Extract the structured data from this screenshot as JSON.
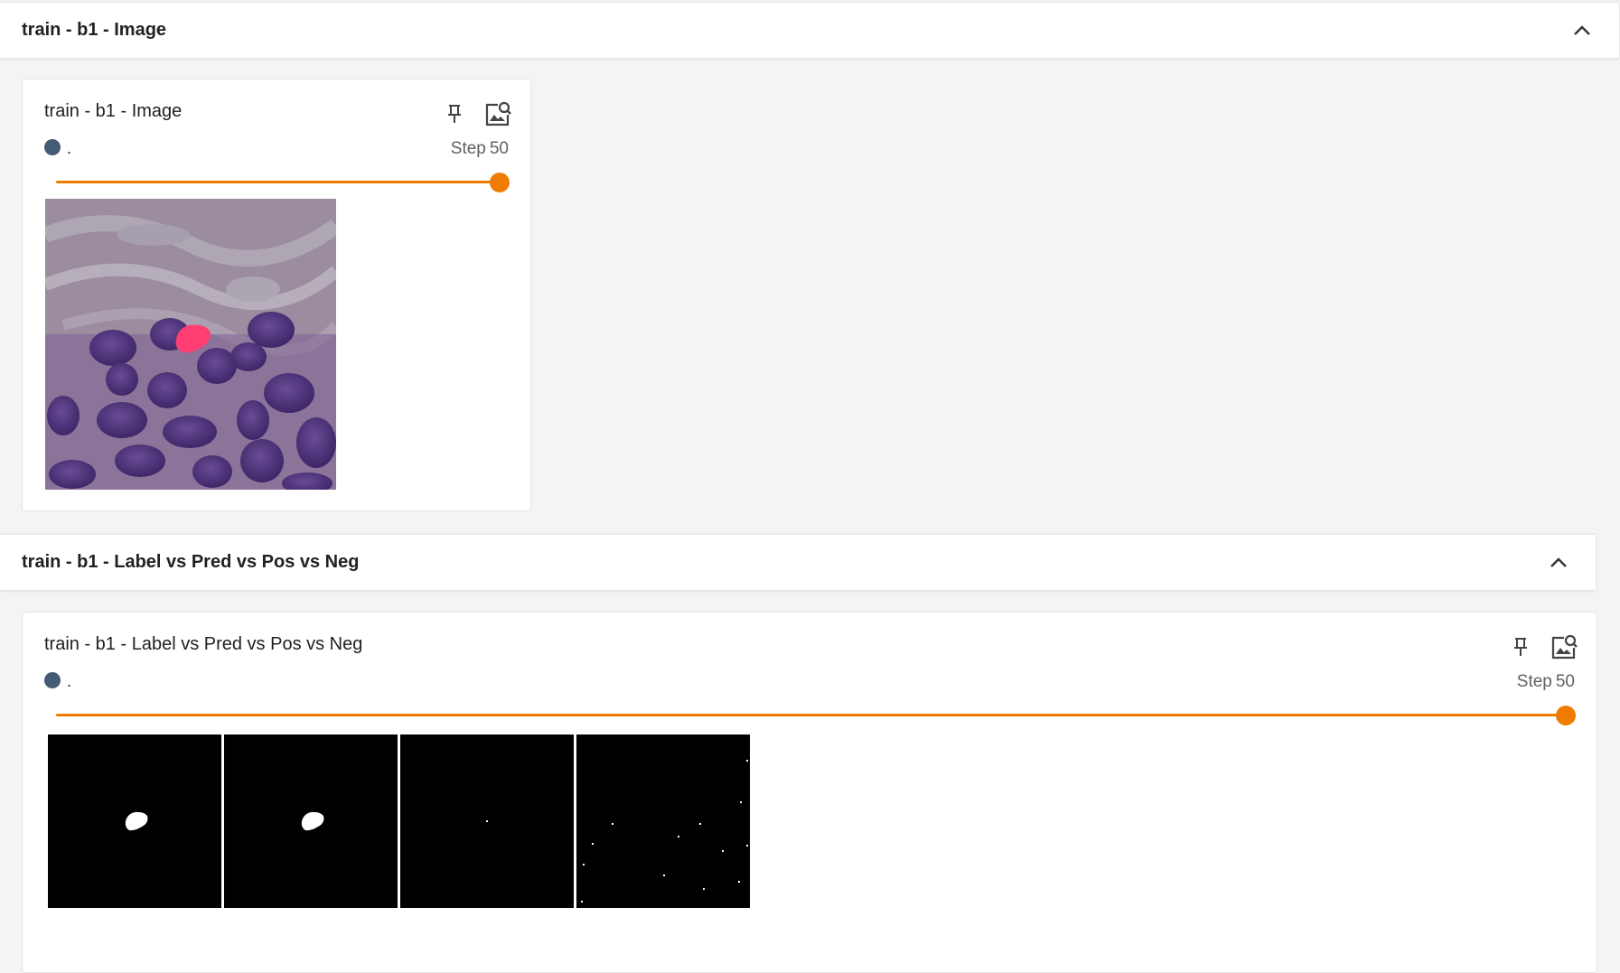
{
  "colors": {
    "accent": "#ef7c00",
    "run_dot": "#455a74",
    "mask_highlight": "#ff3f73"
  },
  "groups": [
    {
      "header_title": "train - b1 - Image",
      "card": {
        "title": "train - b1 - Image",
        "run_name": ".",
        "step_prefix": "Step",
        "step_value": "50",
        "slider_fraction": 1.0,
        "pin_icon": "pin-icon",
        "zoom_icon": "image-search-icon",
        "image_description_icon": "histology-image"
      }
    },
    {
      "header_title": "train - b1 - Label vs Pred vs Pos vs Neg",
      "card": {
        "title": "train - b1 - Label vs Pred vs Pos vs Neg",
        "run_name": ".",
        "step_prefix": "Step",
        "step_value": "50",
        "slider_fraction": 1.0,
        "pin_icon": "pin-icon",
        "zoom_icon": "image-search-icon",
        "panels": [
          "label-mask",
          "pred-mask",
          "pos-mask",
          "neg-mask"
        ]
      }
    }
  ]
}
